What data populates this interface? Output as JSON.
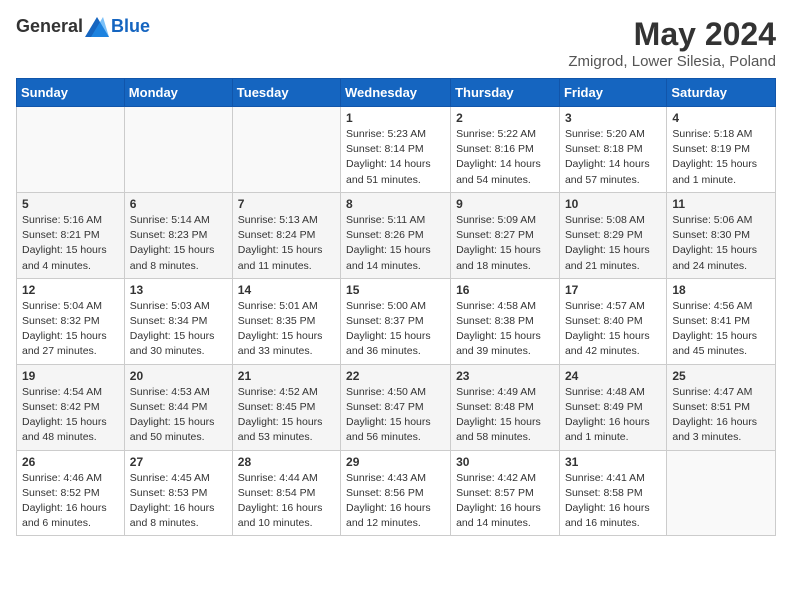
{
  "header": {
    "logo_general": "General",
    "logo_blue": "Blue",
    "month_title": "May 2024",
    "location": "Zmigrod, Lower Silesia, Poland"
  },
  "weekdays": [
    "Sunday",
    "Monday",
    "Tuesday",
    "Wednesday",
    "Thursday",
    "Friday",
    "Saturday"
  ],
  "weeks": [
    [
      {
        "day": "",
        "sunrise": "",
        "sunset": "",
        "daylight": ""
      },
      {
        "day": "",
        "sunrise": "",
        "sunset": "",
        "daylight": ""
      },
      {
        "day": "",
        "sunrise": "",
        "sunset": "",
        "daylight": ""
      },
      {
        "day": "1",
        "sunrise": "Sunrise: 5:23 AM",
        "sunset": "Sunset: 8:14 PM",
        "daylight": "Daylight: 14 hours and 51 minutes."
      },
      {
        "day": "2",
        "sunrise": "Sunrise: 5:22 AM",
        "sunset": "Sunset: 8:16 PM",
        "daylight": "Daylight: 14 hours and 54 minutes."
      },
      {
        "day": "3",
        "sunrise": "Sunrise: 5:20 AM",
        "sunset": "Sunset: 8:18 PM",
        "daylight": "Daylight: 14 hours and 57 minutes."
      },
      {
        "day": "4",
        "sunrise": "Sunrise: 5:18 AM",
        "sunset": "Sunset: 8:19 PM",
        "daylight": "Daylight: 15 hours and 1 minute."
      }
    ],
    [
      {
        "day": "5",
        "sunrise": "Sunrise: 5:16 AM",
        "sunset": "Sunset: 8:21 PM",
        "daylight": "Daylight: 15 hours and 4 minutes."
      },
      {
        "day": "6",
        "sunrise": "Sunrise: 5:14 AM",
        "sunset": "Sunset: 8:23 PM",
        "daylight": "Daylight: 15 hours and 8 minutes."
      },
      {
        "day": "7",
        "sunrise": "Sunrise: 5:13 AM",
        "sunset": "Sunset: 8:24 PM",
        "daylight": "Daylight: 15 hours and 11 minutes."
      },
      {
        "day": "8",
        "sunrise": "Sunrise: 5:11 AM",
        "sunset": "Sunset: 8:26 PM",
        "daylight": "Daylight: 15 hours and 14 minutes."
      },
      {
        "day": "9",
        "sunrise": "Sunrise: 5:09 AM",
        "sunset": "Sunset: 8:27 PM",
        "daylight": "Daylight: 15 hours and 18 minutes."
      },
      {
        "day": "10",
        "sunrise": "Sunrise: 5:08 AM",
        "sunset": "Sunset: 8:29 PM",
        "daylight": "Daylight: 15 hours and 21 minutes."
      },
      {
        "day": "11",
        "sunrise": "Sunrise: 5:06 AM",
        "sunset": "Sunset: 8:30 PM",
        "daylight": "Daylight: 15 hours and 24 minutes."
      }
    ],
    [
      {
        "day": "12",
        "sunrise": "Sunrise: 5:04 AM",
        "sunset": "Sunset: 8:32 PM",
        "daylight": "Daylight: 15 hours and 27 minutes."
      },
      {
        "day": "13",
        "sunrise": "Sunrise: 5:03 AM",
        "sunset": "Sunset: 8:34 PM",
        "daylight": "Daylight: 15 hours and 30 minutes."
      },
      {
        "day": "14",
        "sunrise": "Sunrise: 5:01 AM",
        "sunset": "Sunset: 8:35 PM",
        "daylight": "Daylight: 15 hours and 33 minutes."
      },
      {
        "day": "15",
        "sunrise": "Sunrise: 5:00 AM",
        "sunset": "Sunset: 8:37 PM",
        "daylight": "Daylight: 15 hours and 36 minutes."
      },
      {
        "day": "16",
        "sunrise": "Sunrise: 4:58 AM",
        "sunset": "Sunset: 8:38 PM",
        "daylight": "Daylight: 15 hours and 39 minutes."
      },
      {
        "day": "17",
        "sunrise": "Sunrise: 4:57 AM",
        "sunset": "Sunset: 8:40 PM",
        "daylight": "Daylight: 15 hours and 42 minutes."
      },
      {
        "day": "18",
        "sunrise": "Sunrise: 4:56 AM",
        "sunset": "Sunset: 8:41 PM",
        "daylight": "Daylight: 15 hours and 45 minutes."
      }
    ],
    [
      {
        "day": "19",
        "sunrise": "Sunrise: 4:54 AM",
        "sunset": "Sunset: 8:42 PM",
        "daylight": "Daylight: 15 hours and 48 minutes."
      },
      {
        "day": "20",
        "sunrise": "Sunrise: 4:53 AM",
        "sunset": "Sunset: 8:44 PM",
        "daylight": "Daylight: 15 hours and 50 minutes."
      },
      {
        "day": "21",
        "sunrise": "Sunrise: 4:52 AM",
        "sunset": "Sunset: 8:45 PM",
        "daylight": "Daylight: 15 hours and 53 minutes."
      },
      {
        "day": "22",
        "sunrise": "Sunrise: 4:50 AM",
        "sunset": "Sunset: 8:47 PM",
        "daylight": "Daylight: 15 hours and 56 minutes."
      },
      {
        "day": "23",
        "sunrise": "Sunrise: 4:49 AM",
        "sunset": "Sunset: 8:48 PM",
        "daylight": "Daylight: 15 hours and 58 minutes."
      },
      {
        "day": "24",
        "sunrise": "Sunrise: 4:48 AM",
        "sunset": "Sunset: 8:49 PM",
        "daylight": "Daylight: 16 hours and 1 minute."
      },
      {
        "day": "25",
        "sunrise": "Sunrise: 4:47 AM",
        "sunset": "Sunset: 8:51 PM",
        "daylight": "Daylight: 16 hours and 3 minutes."
      }
    ],
    [
      {
        "day": "26",
        "sunrise": "Sunrise: 4:46 AM",
        "sunset": "Sunset: 8:52 PM",
        "daylight": "Daylight: 16 hours and 6 minutes."
      },
      {
        "day": "27",
        "sunrise": "Sunrise: 4:45 AM",
        "sunset": "Sunset: 8:53 PM",
        "daylight": "Daylight: 16 hours and 8 minutes."
      },
      {
        "day": "28",
        "sunrise": "Sunrise: 4:44 AM",
        "sunset": "Sunset: 8:54 PM",
        "daylight": "Daylight: 16 hours and 10 minutes."
      },
      {
        "day": "29",
        "sunrise": "Sunrise: 4:43 AM",
        "sunset": "Sunset: 8:56 PM",
        "daylight": "Daylight: 16 hours and 12 minutes."
      },
      {
        "day": "30",
        "sunrise": "Sunrise: 4:42 AM",
        "sunset": "Sunset: 8:57 PM",
        "daylight": "Daylight: 16 hours and 14 minutes."
      },
      {
        "day": "31",
        "sunrise": "Sunrise: 4:41 AM",
        "sunset": "Sunset: 8:58 PM",
        "daylight": "Daylight: 16 hours and 16 minutes."
      },
      {
        "day": "",
        "sunrise": "",
        "sunset": "",
        "daylight": ""
      }
    ]
  ]
}
